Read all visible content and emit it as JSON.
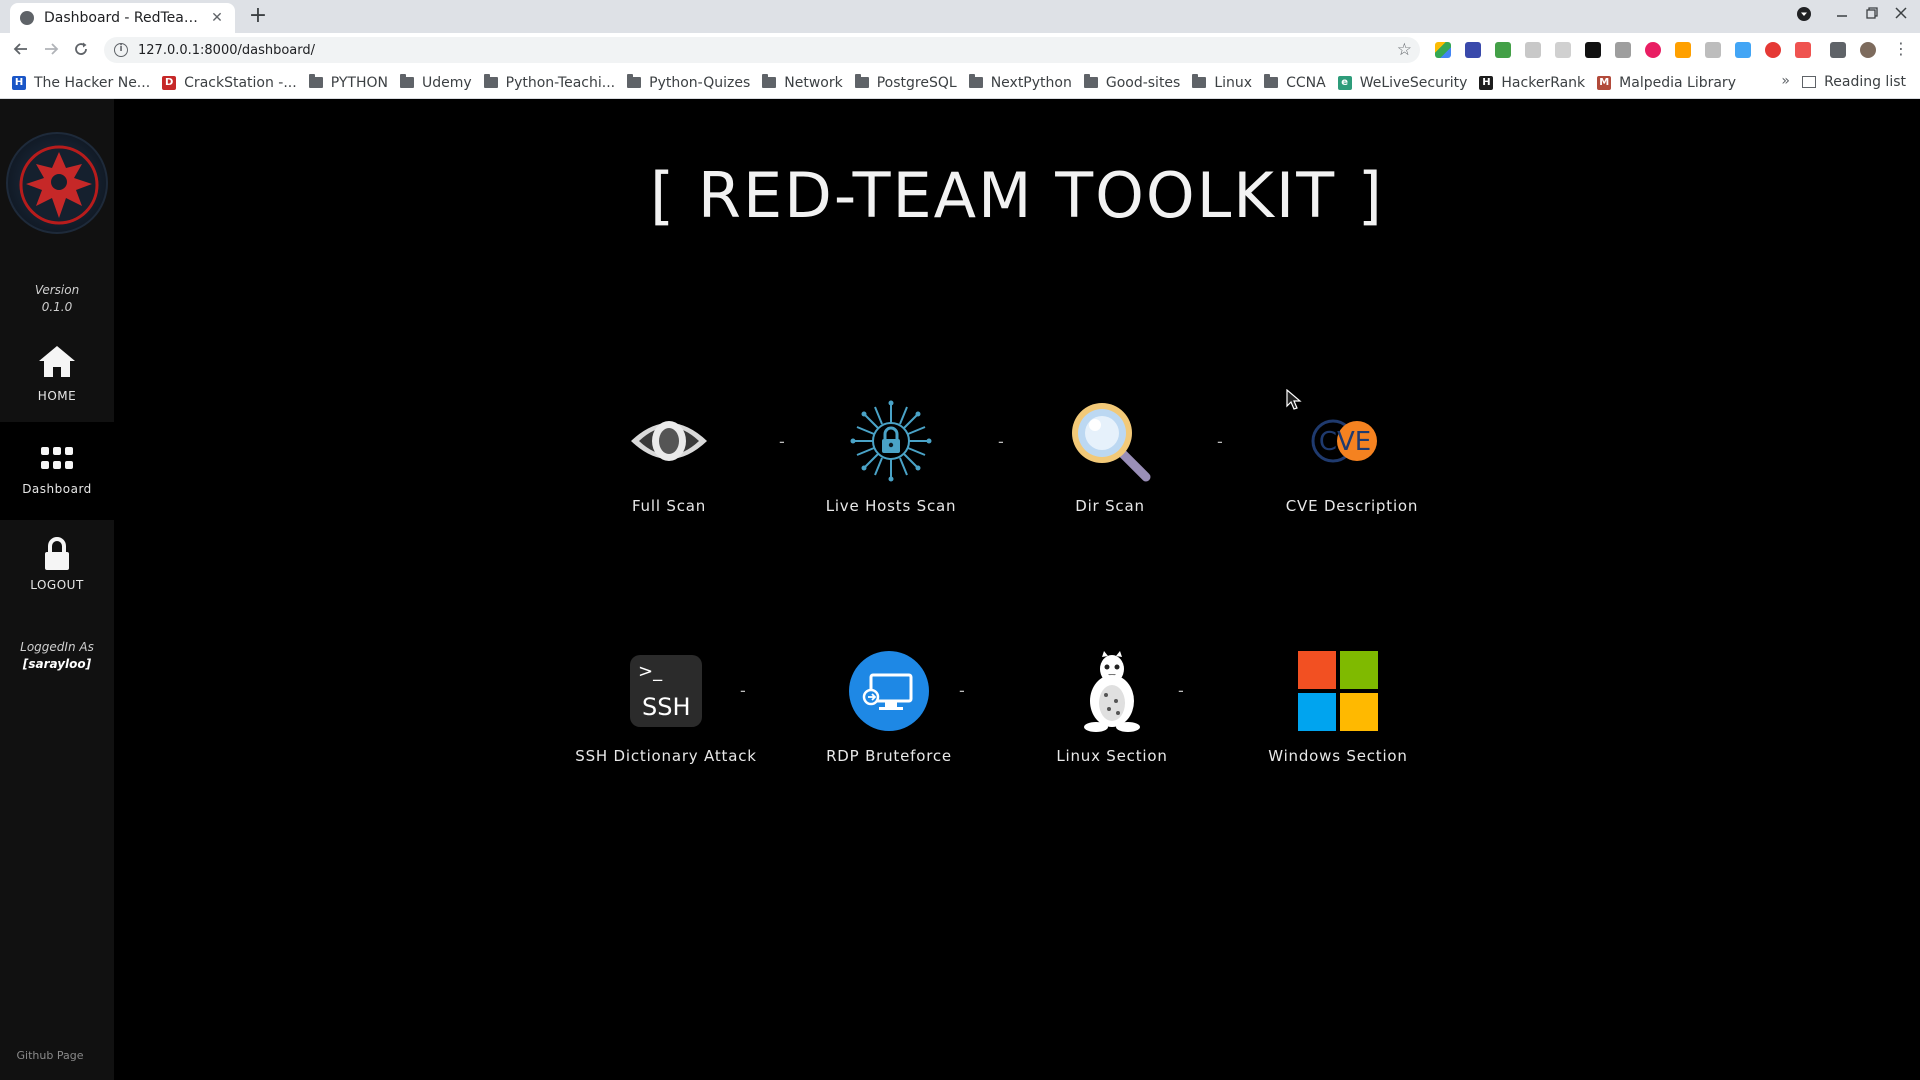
{
  "browser": {
    "tab_title": "Dashboard - RedTeam Toolkit",
    "tab_close": "✕",
    "new_tab": "+",
    "url": "127.0.0.1:8000/dashboard/",
    "bookmarks": [
      {
        "label": "The Hacker Ne...",
        "icon": "hacker-news-icon",
        "color": "#1a56c7",
        "glyph": "H"
      },
      {
        "label": "CrackStation -...",
        "icon": "crackstation-icon",
        "color": "#c62828",
        "glyph": "D"
      },
      {
        "label": "PYTHON",
        "icon": "folder-icon"
      },
      {
        "label": "Udemy",
        "icon": "folder-icon"
      },
      {
        "label": "Python-Teachi...",
        "icon": "folder-icon"
      },
      {
        "label": "Python-Quizes",
        "icon": "folder-icon"
      },
      {
        "label": "Network",
        "icon": "folder-icon"
      },
      {
        "label": "PostgreSQL",
        "icon": "folder-icon"
      },
      {
        "label": "NextPython",
        "icon": "folder-icon"
      },
      {
        "label": "Good-sites",
        "icon": "folder-icon"
      },
      {
        "label": "Linux",
        "icon": "folder-icon"
      },
      {
        "label": "CCNA",
        "icon": "folder-icon"
      },
      {
        "label": "WeLiveSecurity",
        "icon": "welivesecurity-icon",
        "color": "#2e9c7a",
        "glyph": "e"
      },
      {
        "label": "HackerRank",
        "icon": "hackerrank-icon",
        "color": "#1d1d1d",
        "glyph": "H"
      },
      {
        "label": "Malpedia Library",
        "icon": "malpedia-icon",
        "color": "#b24a3a",
        "glyph": "M"
      }
    ],
    "more_bookmarks": "»",
    "reading_list": "Reading list"
  },
  "sidebar": {
    "version_label": "Version",
    "version_number": "0.1.0",
    "nav": [
      {
        "label": "HOME",
        "icon": "home-icon"
      },
      {
        "label": "Dashboard",
        "icon": "grid-icon"
      },
      {
        "label": "LOGOUT",
        "icon": "lock-icon"
      }
    ],
    "logged_in_label": "LoggedIn As",
    "username": "[sarayloo]",
    "github": "Github Page"
  },
  "main": {
    "title": "[ RED-TEAM TOOLKIT ]",
    "separator": "-",
    "row1": [
      {
        "label": "Full Scan",
        "icon": "eye-icon"
      },
      {
        "label": "Live Hosts Scan",
        "icon": "circuit-lock-icon"
      },
      {
        "label": "Dir Scan",
        "icon": "magnifier-icon"
      },
      {
        "label": "CVE Description",
        "icon": "cve-icon"
      }
    ],
    "row2": [
      {
        "label": "SSH Dictionary Attack",
        "icon": "ssh-terminal-icon",
        "icon_text": "SSH",
        "prompt": ">_"
      },
      {
        "label": "RDP Bruteforce",
        "icon": "rdp-monitor-icon"
      },
      {
        "label": "Linux Section",
        "icon": "tux-icon"
      },
      {
        "label": "Windows Section",
        "icon": "windows-logo-icon"
      }
    ],
    "cve_letters": "CVE"
  },
  "colors": {
    "sidebar_bg": "#111111",
    "main_bg": "#000000",
    "rdp_blue": "#1e88e5",
    "win_red": "#f25022",
    "win_green": "#7fba00",
    "win_blue": "#00a4ef",
    "win_yellow": "#ffb900"
  }
}
